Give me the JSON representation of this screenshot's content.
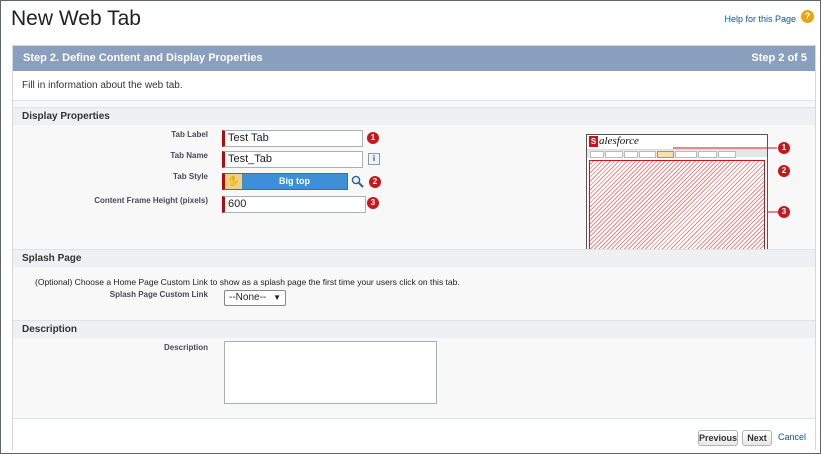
{
  "page_title": "New Web Tab",
  "help": {
    "label": "Help for this Page",
    "icon": "question-icon",
    "icon_glyph": "?"
  },
  "step": {
    "title": "Step 2. Define Content and Display Properties",
    "count": "Step 2 of 5"
  },
  "intro": "Fill in information about the web tab.",
  "display": {
    "heading": "Display Properties",
    "tab_label": {
      "label": "Tab Label",
      "value": "Test Tab",
      "badge": "1"
    },
    "tab_name": {
      "label": "Tab Name",
      "value": "Test_Tab",
      "info": "i"
    },
    "tab_style": {
      "label": "Tab Style",
      "value": "Big top",
      "badge": "2"
    },
    "frame_height": {
      "label": "Content Frame Height (pixels)",
      "value": "600",
      "badge": "3"
    }
  },
  "preview": {
    "logo_letter": "S",
    "logo_text": "alesforce",
    "badges": [
      "1",
      "2",
      "3"
    ]
  },
  "splash": {
    "heading": "Splash Page",
    "instruction": "(Optional) Choose a Home Page Custom Link to show as a splash page the first time your users click on this tab.",
    "link_label": "Splash Page Custom Link",
    "selected": "--None--"
  },
  "description": {
    "heading": "Description",
    "label": "Description",
    "value": ""
  },
  "buttons": {
    "previous": "Previous",
    "next": "Next",
    "cancel": "Cancel"
  },
  "colors": {
    "step_bar": "#8a9ebe",
    "required": "#cc0000",
    "badge": "#c8161d",
    "link": "#015ba7",
    "style_blue": "#3e8fd8"
  }
}
